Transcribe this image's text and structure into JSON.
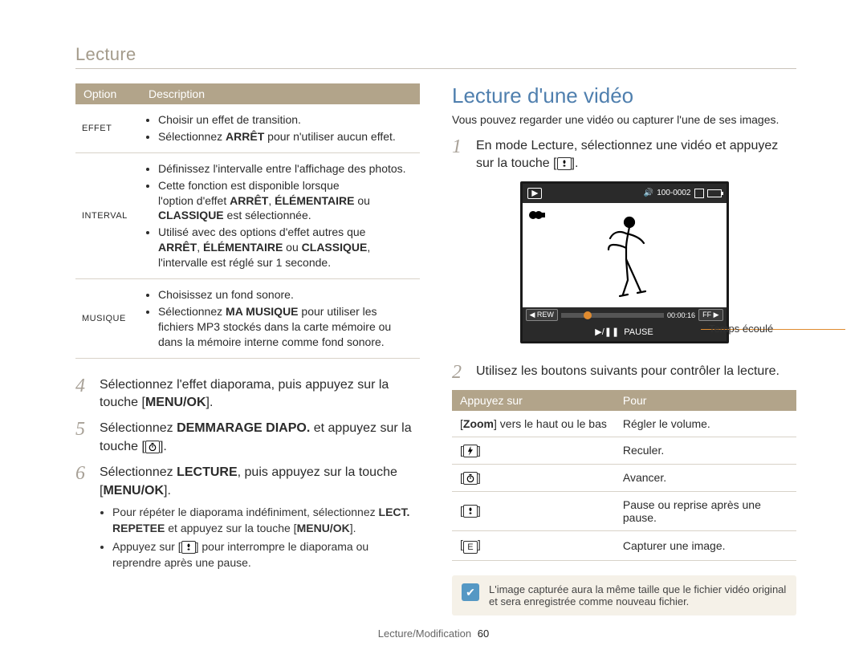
{
  "header": {
    "title": "Lecture"
  },
  "left": {
    "table1": {
      "headers": {
        "opt": "Option",
        "desc": "Description"
      },
      "rows": {
        "effet": {
          "name": "EFFET",
          "l1": "Choisir un effet de transition.",
          "l2a": "Sélectionnez ",
          "l2b": "ARRÊT",
          "l2c": " pour n'utiliser aucun effet."
        },
        "interval": {
          "name": "INTERVAL",
          "l1": "Définissez l'intervalle entre l'affichage des photos.",
          "l2": "Cette fonction est disponible lorsque",
          "l3a": "l'option d'effet ",
          "l3b": "ARRÊT",
          "l3c": ", ",
          "l3d": "ÉLÉMENTAIRE",
          "l3e": " ou",
          "l4a": "CLASSIQUE",
          "l4b": " est sélectionnée.",
          "l5": "Utilisé avec des options d'effet autres que",
          "l6a": "ARRÊT",
          "l6b": ", ",
          "l6c": "ÉLÉMENTAIRE",
          "l6d": " ou ",
          "l6e": "CLASSIQUE",
          "l6f": ",",
          "l7": "l'intervalle est réglé sur 1 seconde."
        },
        "musique": {
          "name": "MUSIQUE",
          "l1": "Choisissez un fond sonore.",
          "l2a": "Sélectionnez ",
          "l2b": "MA MUSIQUE",
          "l2c": " pour utiliser les",
          "l3": "fichiers MP3 stockés dans la carte mémoire ou",
          "l4": "dans la mémoire interne comme fond sonore."
        }
      }
    },
    "steps": {
      "s4": {
        "n": "4",
        "a": "Sélectionnez l'effet diaporama, puis appuyez sur la touche [",
        "b": "MENU/OK",
        "c": "]."
      },
      "s5": {
        "n": "5",
        "a": "Sélectionnez ",
        "b": "DEMMARAGE DIAPO.",
        "c": " et appuyez sur la touche [",
        "d": "]."
      },
      "s6": {
        "n": "6",
        "a": "Sélectionnez ",
        "b": "LECTURE",
        "c": ", puis appuyez sur la touche [",
        "d": "MENU/OK",
        "e": "].",
        "bul1a": "Pour répéter le diaporama indéfiniment, sélectionnez ",
        "bul1b": "LECT. REPETEE",
        "bul1c": " et appuyez sur la touche [",
        "bul1d": "MENU/OK",
        "bul1e": "].",
        "bul2a": "Appuyez sur [",
        "bul2b": "] pour interrompre le diaporama ou reprendre après une pause."
      }
    }
  },
  "right": {
    "title": "Lecture d'une vidéo",
    "intro": "Vous pouvez regarder une vidéo ou capturer l'une de ses images.",
    "step1": {
      "n": "1",
      "a": "En mode Lecture, sélectionnez une vidéo et appuyez sur la touche [",
      "b": "]."
    },
    "screen": {
      "counter": "100-0002",
      "rew": "REW",
      "time": "00:00:16",
      "ff": "FF",
      "pause": "PAUSE",
      "leader": "Temps écoulé"
    },
    "step2": {
      "n": "2",
      "text": "Utilisez les boutons suivants pour contrôler la lecture."
    },
    "ctrl": {
      "headers": {
        "k": "Appuyez sur",
        "v": "Pour"
      },
      "rows": {
        "zoom": {
          "k1": "[",
          "k2": "Zoom",
          "k3": "] vers le haut ou le bas",
          "v": "Régler le volume."
        },
        "back": {
          "v": "Reculer."
        },
        "fwd": {
          "v": "Avancer."
        },
        "pause": {
          "v": "Pause ou reprise après une pause."
        },
        "cap": {
          "k": "E",
          "v": "Capturer une image."
        }
      }
    },
    "note": "L'image capturée aura la même taille que le fichier vidéo original et sera enregistrée comme nouveau fichier."
  },
  "footer": {
    "section": "Lecture/Modification",
    "page": "60"
  }
}
